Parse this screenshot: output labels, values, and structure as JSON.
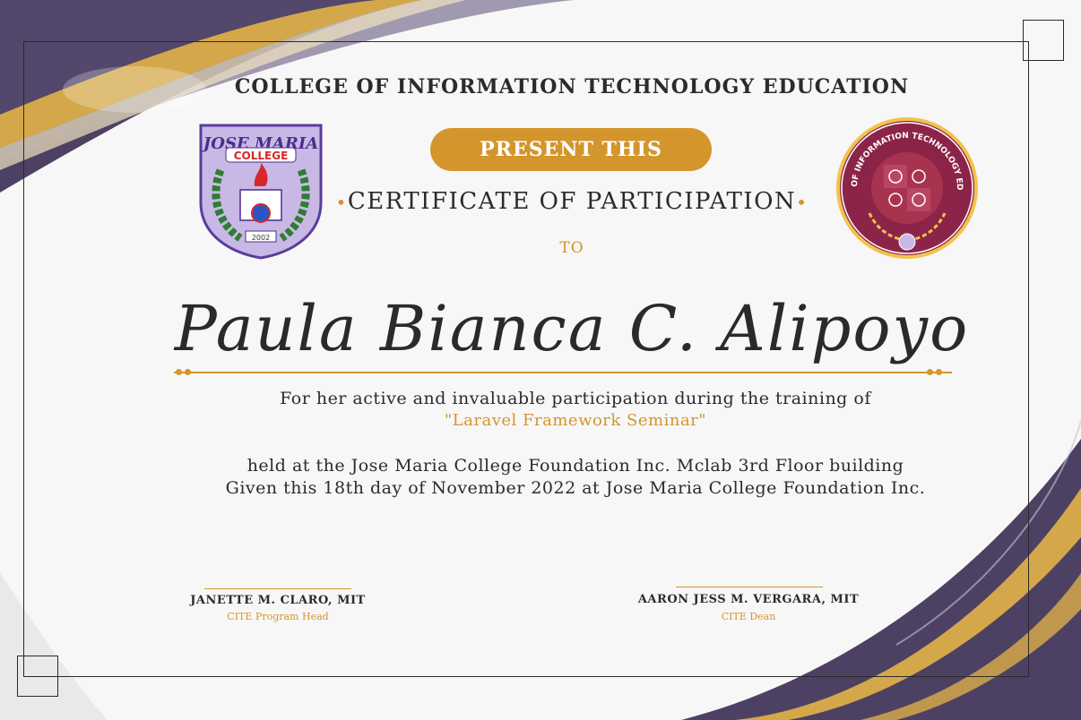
{
  "header": {
    "college": "COLLEGE OF INFORMATION TECHNOLOGY EDUCATION"
  },
  "badge": {
    "label": "PRESENT THIS"
  },
  "certificate": {
    "title": "CERTIFICATE OF PARTICIPATION",
    "to": "TO",
    "recipient": "Paula Bianca C. Alipoyo",
    "reason": "For her active and invaluable participation during the training of",
    "event": "\"Laravel Framework Seminar\"",
    "venue": "held at the Jose Maria College Foundation Inc. Mclab 3rd Floor building",
    "given": "Given this 18th day of November 2022 at Jose Maria College Foundation Inc."
  },
  "left_logo": {
    "top": "JOSE MARIA",
    "middle": "COLLEGE",
    "year": "2002"
  },
  "right_logo": {
    "ring": "COLLEGE OF INFORMATION TECHNOLOGY EDUCATION"
  },
  "signatories": [
    {
      "name": "JANETTE M. CLARO, MIT",
      "role": "CITE Program Head"
    },
    {
      "name": "AARON JESS M. VERGARA, MIT",
      "role": "CITE Dean"
    }
  ],
  "colors": {
    "accent": "#d4952c",
    "purple": "#4a3e63",
    "maroon": "#8c2449"
  }
}
